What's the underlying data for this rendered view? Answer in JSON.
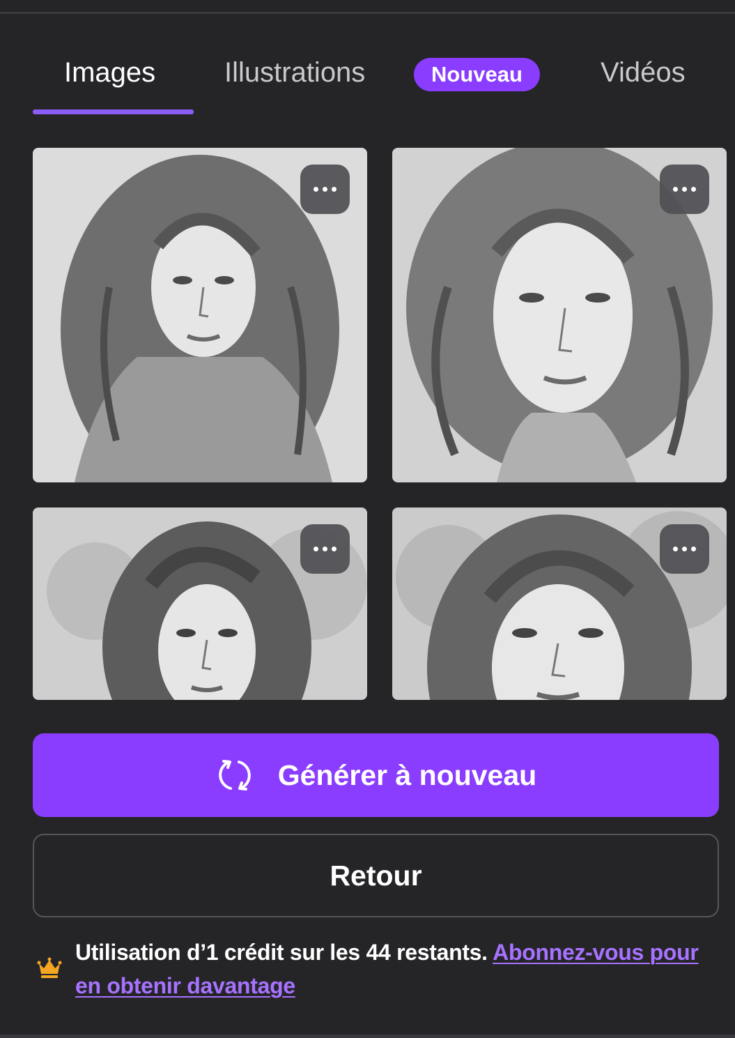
{
  "tabs": [
    {
      "label": "Images",
      "active": true
    },
    {
      "label": "Illustrations",
      "active": false,
      "badge": "Nouveau"
    },
    {
      "label": "Vidéos",
      "active": false
    }
  ],
  "gallery": {
    "items": [
      {
        "subject": "pencil sketch portrait, woman with long wavy hair",
        "menu_icon": "more-horizontal-icon"
      },
      {
        "subject": "pencil sketch portrait, woman with wavy hair and knit collar",
        "menu_icon": "more-horizontal-icon"
      },
      {
        "subject": "pencil sketch portrait, woman with curly hair and floral background",
        "menu_icon": "more-horizontal-icon"
      },
      {
        "subject": "pencil sketch portrait, woman with long hair and floral background",
        "menu_icon": "more-horizontal-icon"
      }
    ]
  },
  "actions": {
    "regenerate_label": "Générer à nouveau",
    "regenerate_icon": "refresh-icon",
    "back_label": "Retour"
  },
  "credits": {
    "icon": "crown-icon",
    "text": "Utilisation d’1 crédit sur les 44 restants.",
    "link_label": "Abonnez-vous pour en obtenir davantage"
  },
  "colors": {
    "background": "#252528",
    "accent": "#8b3dff",
    "link": "#a772ff",
    "crown": "#f5a623"
  }
}
